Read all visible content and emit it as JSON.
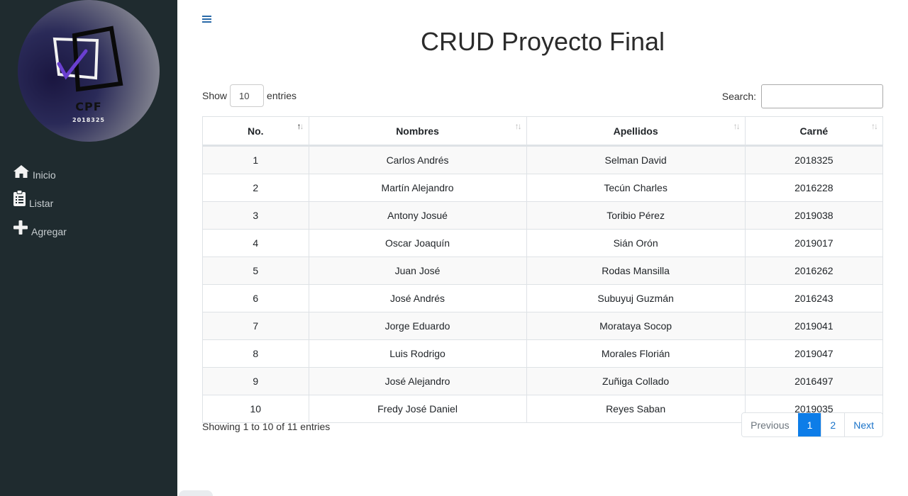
{
  "logo": {
    "title": "CPF",
    "subtitle": "2018325"
  },
  "sidebar": {
    "items": [
      {
        "label": "Inicio",
        "icon": "home-icon"
      },
      {
        "label": "Listar",
        "icon": "clipboard-list-icon"
      },
      {
        "label": "Agregar",
        "icon": "plus-icon"
      }
    ]
  },
  "header": {
    "title": "CRUD Proyecto Final"
  },
  "length_control": {
    "show_label": "Show",
    "value": "10",
    "entries_label": "entries"
  },
  "search": {
    "label": "Search:",
    "value": ""
  },
  "table": {
    "headers": [
      "No.",
      "Nombres",
      "Apellidos",
      "Carné"
    ],
    "rows": [
      [
        "1",
        "Carlos Andrés",
        "Selman David",
        "2018325"
      ],
      [
        "2",
        "Martín Alejandro",
        "Tecún Charles",
        "2016228"
      ],
      [
        "3",
        "Antony Josué",
        "Toribio Pérez",
        "2019038"
      ],
      [
        "4",
        "Oscar Joaquín",
        "Sián Orón",
        "2019017"
      ],
      [
        "5",
        "Juan José",
        "Rodas Mansilla",
        "2016262"
      ],
      [
        "6",
        "José Andrés",
        "Subuyuj Guzmán",
        "2016243"
      ],
      [
        "7",
        "Jorge Eduardo",
        "Morataya Socop",
        "2019041"
      ],
      [
        "8",
        "Luis Rodrigo",
        "Morales Florián",
        "2019047"
      ],
      [
        "9",
        "José Alejandro",
        "Zuñiga Collado",
        "2016497"
      ],
      [
        "10",
        "Fredy José Daniel",
        "Reyes Saban",
        "2019035"
      ]
    ]
  },
  "info": "Showing 1 to 10 of 11 entries",
  "pagination": {
    "previous": "Previous",
    "pages": [
      "1",
      "2"
    ],
    "active_page": "1",
    "next": "Next"
  },
  "colors": {
    "sidebar_bg": "#1f2b2f",
    "accent": "#0d7de8",
    "link": "#1a73c9"
  }
}
